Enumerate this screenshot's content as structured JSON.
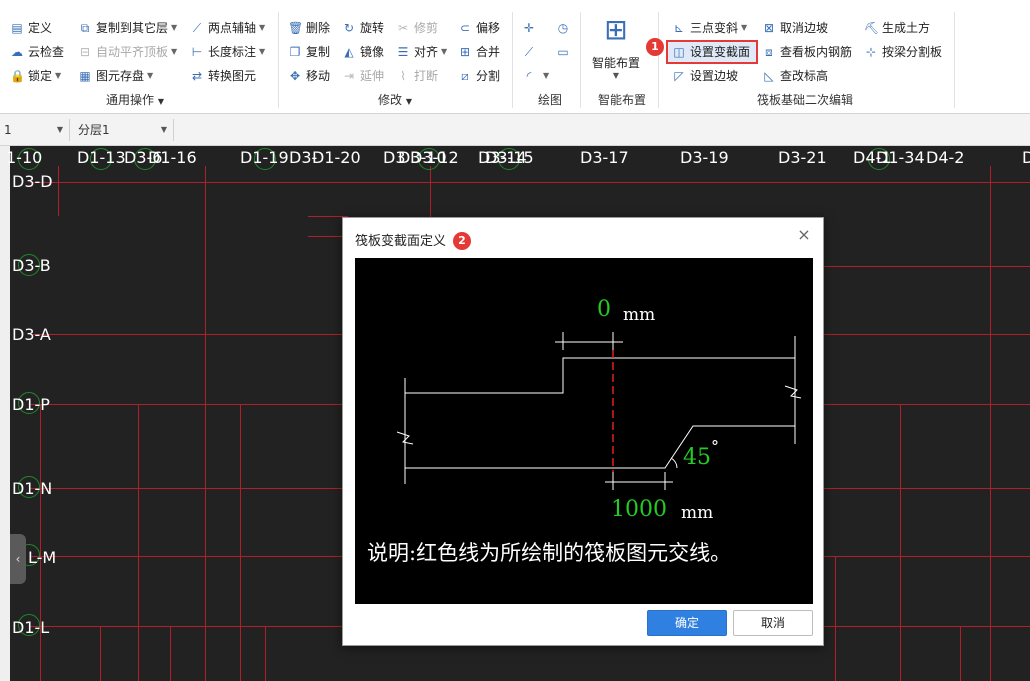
{
  "ribbon": {
    "general": {
      "label": "通用操作",
      "items": {
        "define": "定义",
        "cloud_check": "云检查",
        "lock": "锁定",
        "copy_to_layer": "复制到其它层",
        "auto_align": "自动平齐顶板",
        "save_element": "图元存盘",
        "two_point_axis": "两点辅轴",
        "length_dim": "长度标注",
        "convert_element": "转换图元"
      }
    },
    "modify": {
      "label": "修改",
      "items": {
        "delete": "删除",
        "rotate": "旋转",
        "trim": "修剪",
        "offset": "偏移",
        "copy": "复制",
        "mirror": "镜像",
        "align": "对齐",
        "merge": "合并",
        "move": "移动",
        "extend": "延伸",
        "break": "打断",
        "split": "分割"
      }
    },
    "draw": {
      "label": "绘图"
    },
    "smart": {
      "label": "智能布置",
      "button": "智能布置"
    },
    "raft": {
      "label": "筏板基础二次编辑",
      "items": {
        "three_point_slope": "三点变斜",
        "set_section": "设置变截面",
        "set_slope": "设置边坡",
        "cancel_slope": "取消边坡",
        "view_rebar": "查看板内钢筋",
        "change_elev": "查改标高",
        "gen_earthwork": "生成土方",
        "split_by_beam": "按梁分割板"
      }
    },
    "markers": {
      "one": "1",
      "two": "2"
    }
  },
  "layerbar": {
    "left_value": "1",
    "layer_value": "分层1"
  },
  "canvas": {
    "top_axes": [
      "1-10",
      "D1-13",
      "D3-6",
      "D1-16",
      "D1-19",
      "D3-",
      "D1-20",
      "D3",
      "D3-10",
      "D3-12",
      "D3-14",
      "D3-15",
      "D3-17",
      "D3-19",
      "D3-21",
      "D4-1",
      "D1-34",
      "D4-2",
      "D"
    ],
    "left_axes": [
      "D3-D",
      "D3-B",
      "D3-A",
      "D1-P",
      "D1-N",
      "L-M",
      "D1-L"
    ]
  },
  "dialog": {
    "title": "筏板变截面定义",
    "close": "×",
    "top_value": "0",
    "top_unit": "mm",
    "angle_value": "45",
    "degree": "°",
    "bottom_value": "1000",
    "bottom_unit": "mm",
    "note": "说明:红色线为所绘制的筏板图元交线。",
    "ok": "确定",
    "cancel": "取消"
  }
}
